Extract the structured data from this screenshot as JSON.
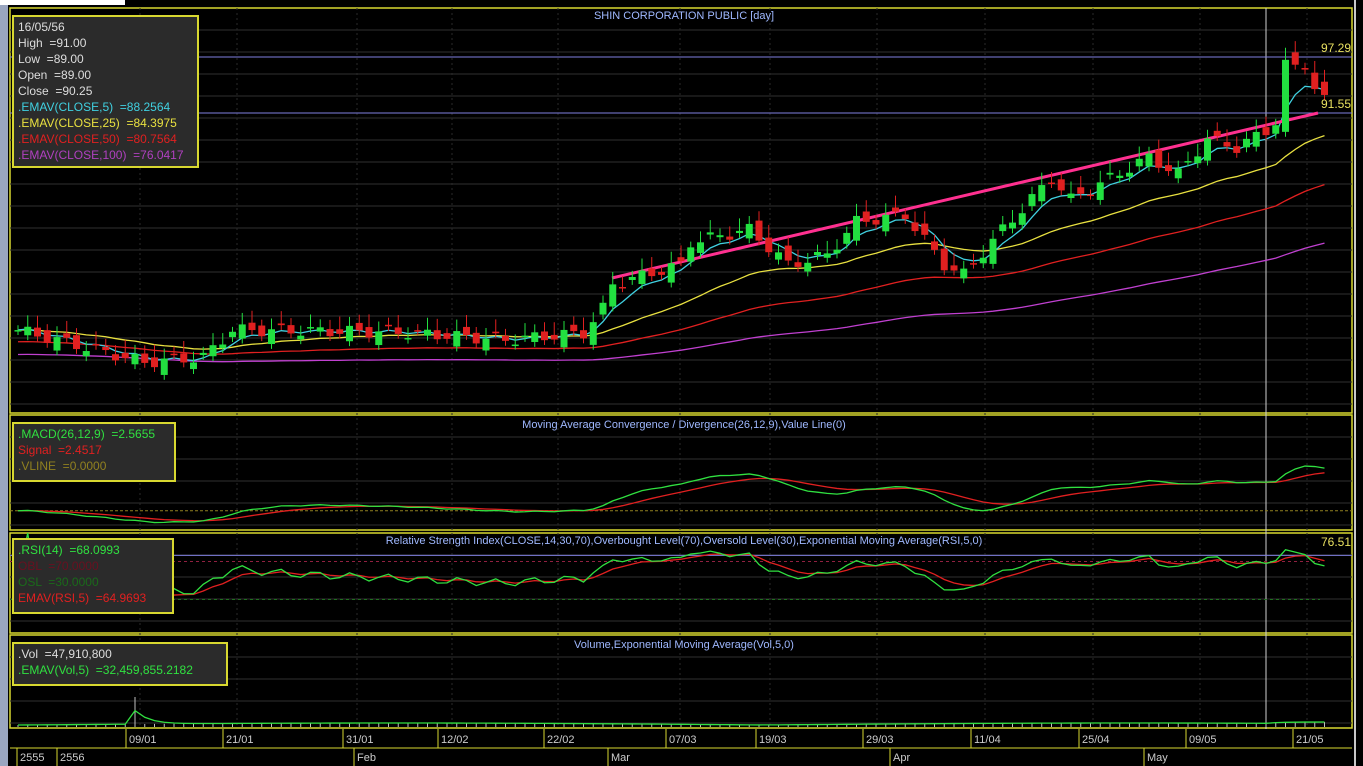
{
  "title": "SHIN CORPORATION PUBLIC [day]",
  "info": {
    "date": "16/05/56",
    "high": "High  =91.00",
    "low": "Low  =89.00",
    "open": "Open  =89.00",
    "close": "Close  =90.25",
    "ema5": ".EMAV(CLOSE,5)  =88.2564",
    "ema25": ".EMAV(CLOSE,25)  =84.3975",
    "ema50": ".EMAV(CLOSE,50)  =80.7564",
    "ema100": ".EMAV(CLOSE,100)  =76.0417"
  },
  "macd": {
    "title": "Moving Average Convergence / Divergence(26,12,9),Value Line(0)",
    "macd": ".MACD(26,12,9)  =2.5655",
    "signal": "Signal  =2.4517",
    "vline": ".VLINE  =0.0000"
  },
  "rsi": {
    "title": "Relative Strength Index(CLOSE,14,30,70),Overbought Level(70),Oversold Level(30),Exponential Moving Average(RSI,5,0)",
    "rsi": ".RSI(14)  =68.0993",
    "obl": "OBL  =70.0000",
    "osl": "OSL  =30.0000",
    "ema": "EMAV(RSI,5)  =64.9693",
    "right_label": "76.51"
  },
  "volume": {
    "title": "Volume,Exponential Moving Average(Vol,5,0)",
    "vol": ".Vol  =47,910,800",
    "ema": ".EMAV(Vol,5)  =32,459,855.2182"
  },
  "price_labels": {
    "upper": "97.29",
    "lower": "91.55"
  },
  "dates": [
    "09/01",
    "21/01",
    "31/01",
    "12/02",
    "22/02",
    "07/03",
    "19/03",
    "29/03",
    "11/04",
    "25/04",
    "09/05",
    "21/05"
  ],
  "periods": [
    "2555",
    "2556",
    "Feb",
    "Mar",
    "Apr",
    "May"
  ],
  "colors": {
    "up": "#22e040",
    "down": "#e02020",
    "ema5": "#40d0e0",
    "ema25": "#e8e040",
    "ema50": "#e02020",
    "ema100": "#c040d0",
    "trend": "#ff3090",
    "frame": "#d8d830"
  },
  "chart_data": {
    "type": "candlestick",
    "bars": 135,
    "price_keypoints": [
      [
        0,
        69.3
      ],
      [
        13,
        66
      ],
      [
        19,
        66.5
      ],
      [
        22,
        69.3
      ],
      [
        39,
        69.1
      ],
      [
        50,
        68.3
      ],
      [
        58,
        69
      ],
      [
        60,
        71.5
      ],
      [
        61,
        74
      ],
      [
        68,
        76
      ],
      [
        69,
        78.3
      ],
      [
        75,
        79.6
      ],
      [
        79,
        76
      ],
      [
        83,
        77
      ],
      [
        86,
        80.4
      ],
      [
        91,
        81.1
      ],
      [
        95,
        76
      ],
      [
        97,
        75
      ],
      [
        101,
        79.6
      ],
      [
        106,
        84.9
      ],
      [
        108,
        82.7
      ],
      [
        116,
        87
      ],
      [
        119,
        85.3
      ],
      [
        122,
        88.9
      ],
      [
        125,
        88
      ],
      [
        129,
        90.3
      ],
      [
        130,
        97
      ],
      [
        131,
        96.5
      ],
      [
        132,
        96
      ],
      [
        133,
        94
      ],
      [
        134,
        93.4
      ]
    ],
    "y_axis": {
      "ref_lines": [
        97.29,
        91.55
      ]
    },
    "volume_spike_bar": 12
  }
}
